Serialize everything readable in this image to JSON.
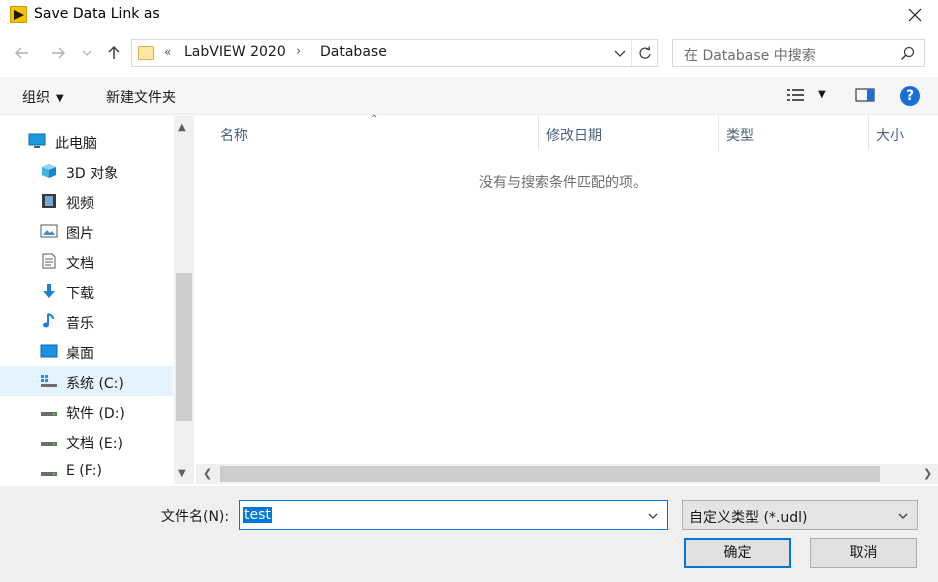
{
  "window": {
    "title": "Save Data Link as"
  },
  "address": {
    "overflow": "«",
    "crumbs": [
      "LabVIEW 2020",
      "Database"
    ]
  },
  "search": {
    "placeholder": "在 Database 中搜索"
  },
  "toolbar": {
    "organize": "组织",
    "new_folder": "新建文件夹"
  },
  "sidebar": {
    "items": [
      {
        "label": "此电脑",
        "icon": "computer-icon"
      },
      {
        "label": "3D 对象",
        "icon": "cube-icon"
      },
      {
        "label": "视频",
        "icon": "video-icon"
      },
      {
        "label": "图片",
        "icon": "picture-icon"
      },
      {
        "label": "文档",
        "icon": "document-icon"
      },
      {
        "label": "下载",
        "icon": "download-icon"
      },
      {
        "label": "音乐",
        "icon": "music-icon"
      },
      {
        "label": "桌面",
        "icon": "desktop-icon"
      },
      {
        "label": "系统 (C:)",
        "icon": "system-drive-icon"
      },
      {
        "label": "软件 (D:)",
        "icon": "drive-icon"
      },
      {
        "label": "文档 (E:)",
        "icon": "drive-icon"
      },
      {
        "label": "E (F:)",
        "icon": "drive-icon"
      }
    ]
  },
  "columns": [
    "名称",
    "修改日期",
    "类型",
    "大小"
  ],
  "empty_message": "没有与搜索条件匹配的项。",
  "bottom": {
    "filename_label": "文件名(N):",
    "filename_value": "test",
    "filetype_value": "自定义类型 (*.udl)",
    "ok_label": "确定",
    "cancel_label": "取消"
  },
  "colors": {
    "accent": "#0078d7",
    "selected_bg": "#e5f3ff"
  }
}
